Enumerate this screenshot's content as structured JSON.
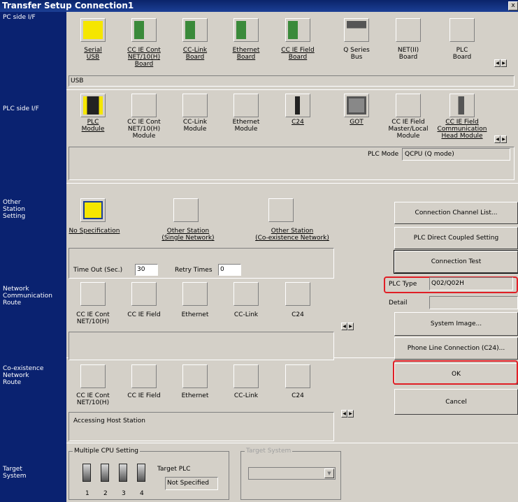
{
  "window": {
    "title": "Transfer Setup Connection1",
    "close_label": "x"
  },
  "sections": {
    "pc_side": "PC side I/F",
    "plc_side": "PLC side I/F",
    "other_station": "Other\nStation\nSetting",
    "network_route": "Network\nCommunication\nRoute",
    "coexistence_route": "Co-existence\nNetwork\nRoute",
    "target_system": "Target\nSystem"
  },
  "pc_side": {
    "items": [
      {
        "label": "Serial\nUSB",
        "icon": "serial-usb-icon",
        "color": "#f5e600"
      },
      {
        "label": "CC IE Cont\nNET/10(H)\nBoard",
        "icon": "cc-ie-cont-board-icon",
        "color": "#3a8a3a"
      },
      {
        "label": "CC-Link\nBoard",
        "icon": "cc-link-board-icon",
        "color": "#3a8a3a"
      },
      {
        "label": "Ethernet\nBoard",
        "icon": "ethernet-board-icon",
        "color": "#3a8a3a"
      },
      {
        "label": "CC IE Field\nBoard",
        "icon": "cc-ie-field-board-icon",
        "color": "#3a8a3a"
      },
      {
        "label": "Q Series\nBus",
        "icon": "q-series-bus-icon",
        "color": "#555"
      },
      {
        "label": "NET(II)\nBoard",
        "icon": "",
        "color": ""
      },
      {
        "label": "PLC\nBoard",
        "icon": "",
        "color": ""
      }
    ],
    "selected_value": "USB"
  },
  "plc_side": {
    "items": [
      {
        "label": "PLC\nModule",
        "icon": "plc-module-icon"
      },
      {
        "label": "CC IE Cont\nNET/10(H)\nModule",
        "icon": ""
      },
      {
        "label": "CC-Link\nModule",
        "icon": ""
      },
      {
        "label": "Ethernet\nModule",
        "icon": ""
      },
      {
        "label": "C24",
        "icon": "c24-icon"
      },
      {
        "label": "GOT",
        "icon": "got-icon"
      },
      {
        "label": "CC IE Field\nMaster/Local\nModule",
        "icon": ""
      },
      {
        "label": "CC IE Field\nCommunication\nHead Module",
        "icon": "cc-ie-field-head-icon"
      }
    ],
    "plc_mode_label": "PLC Mode",
    "plc_mode_value": "QCPU (Q mode)"
  },
  "other_station": {
    "items": [
      {
        "label": "No Specification"
      },
      {
        "label": "Other Station\n(Single Network)"
      },
      {
        "label": "Other Station\n(Co-existence Network)"
      }
    ],
    "timeout_label": "Time Out (Sec.)",
    "timeout_value": "30",
    "retry_label": "Retry Times",
    "retry_value": "0"
  },
  "network_route": {
    "items": [
      "CC IE Cont\nNET/10(H)",
      "CC IE Field",
      "Ethernet",
      "CC-Link",
      "C24"
    ]
  },
  "coexistence_route": {
    "items": [
      "CC IE Cont\nNET/10(H)",
      "CC IE Field",
      "Ethernet",
      "CC-Link",
      "C24"
    ],
    "status": "Accessing Host Station"
  },
  "target_system": {
    "multi_cpu_title": "Multiple CPU Setting",
    "cpu_numbers": [
      "1",
      "2",
      "3",
      "4"
    ],
    "target_plc_label": "Target PLC",
    "target_plc_value": "Not Specified",
    "target_system_title": "Target System"
  },
  "right_panel": {
    "connection_channel_list": "Connection Channel List...",
    "plc_direct_coupled": "PLC Direct Coupled Setting",
    "connection_test": "Connection Test",
    "plc_type_label": "PLC Type",
    "plc_type_value": "Q02/Q02H",
    "detail_label": "Detail",
    "system_image": "System Image...",
    "phone_line": "Phone Line Connection (C24)...",
    "ok": "OK",
    "cancel": "Cancel"
  },
  "colors": {
    "highlight_red": "#e01e25",
    "title_blue": "#0a246a",
    "panel": "#d4d0c8"
  }
}
